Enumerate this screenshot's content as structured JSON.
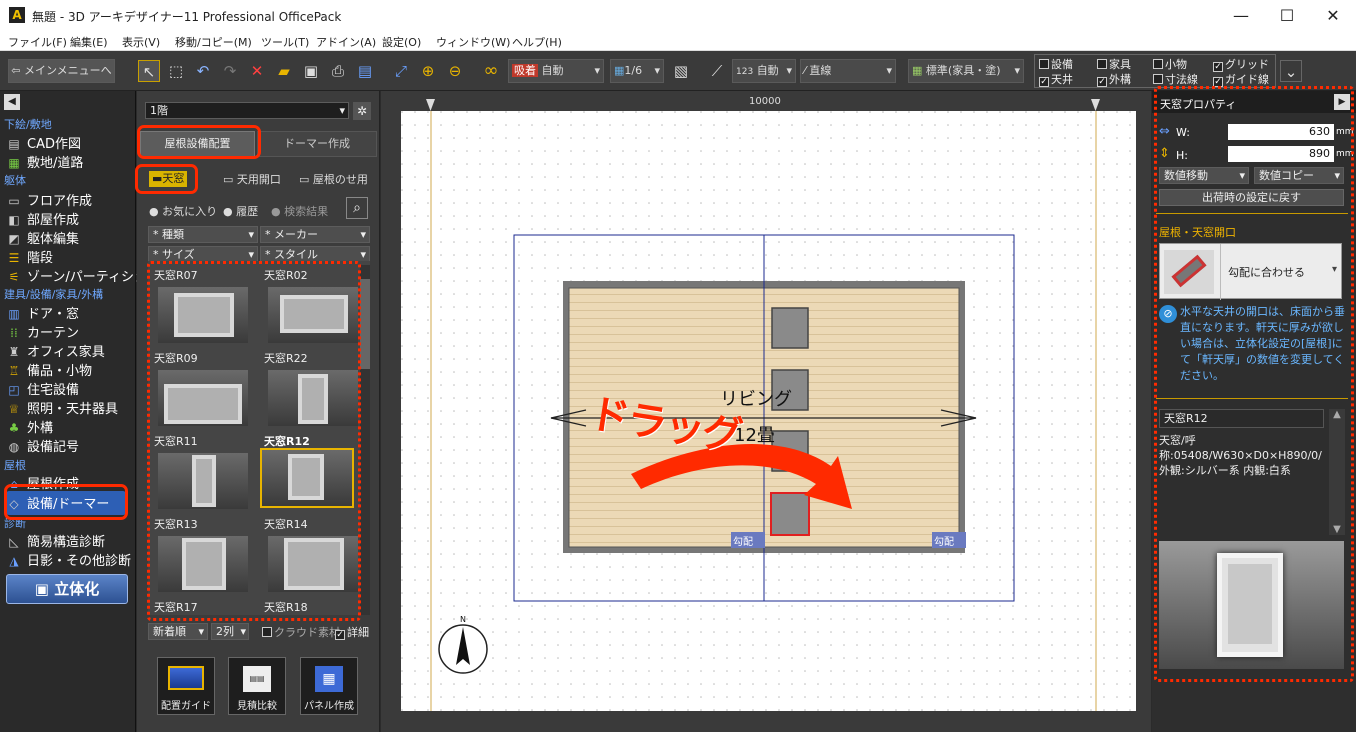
{
  "window": {
    "title": "無題 - 3D アーキデザイナー11 Professional OfficePack",
    "min": "—",
    "max": "☐",
    "close": "✕"
  },
  "menu": [
    "ファイル(F)",
    "編集(E)",
    "表示(V)",
    "移動/コピー(M)",
    "ツール(T)",
    "アドイン(A)",
    "設定(O)",
    "ウィンドウ(W)",
    "ヘルプ(H)"
  ],
  "toolbar": {
    "main_menu": "メインメニューへ",
    "snap_label": "吸着",
    "snap_value": "自動",
    "grid_value": "1/6",
    "dim_value": "自動",
    "line_value": "直線",
    "standard_value": "標準(家具・塗)",
    "checks": [
      {
        "label": "設備",
        "checked": false
      },
      {
        "label": "家具",
        "checked": false
      },
      {
        "label": "小物",
        "checked": false
      },
      {
        "label": "グリッド",
        "checked": true
      },
      {
        "label": "天井",
        "checked": true
      },
      {
        "label": "外構",
        "checked": true
      },
      {
        "label": "寸法線",
        "checked": false
      },
      {
        "label": "ガイド線",
        "checked": true
      }
    ]
  },
  "leftnav": {
    "sections": [
      "下絵/敷地",
      "躯体",
      "建具/設備/家具/外構",
      "屋根",
      "診断"
    ],
    "items": [
      "CAD作図",
      "敷地/道路",
      "フロア作成",
      "部屋作成",
      "躯体編集",
      "階段",
      "ゾーン/パーティション",
      "ドア・窓",
      "カーテン",
      "オフィス家具",
      "備品・小物",
      "住宅設備",
      "照明・天井器具",
      "外構",
      "設備記号",
      "屋根作成",
      "設備/ドーマー",
      "簡易構造診断",
      "日影・その他診断"
    ],
    "render_button": "立体化"
  },
  "panel": {
    "floor": "1階",
    "tabs": [
      "屋根設備配置",
      "ドーマー作成"
    ],
    "categories": [
      "天窓",
      "天用開口",
      "屋根のせ用"
    ],
    "filters": [
      "お気に入り",
      "履歴",
      "検索結果"
    ],
    "dropdowns": [
      "* 種類",
      "* メーカー",
      "* サイズ",
      "* スタイル"
    ],
    "tiles": [
      "天窓R07",
      "天窓R02",
      "天窓R09",
      "天窓R22",
      "天窓R11",
      "天窓R12",
      "天窓R13",
      "天窓R14",
      "天窓R17",
      "天窓R18"
    ],
    "selected_tile": "天窓R12",
    "sort": "新着順",
    "cols": "2列",
    "cloud": "クラウド素材",
    "detail": "詳細",
    "bottom_buttons": [
      "配置ガイド",
      "見積比較",
      "パネル作成"
    ]
  },
  "canvas": {
    "ruler_value": "10000",
    "room_name": "リビング",
    "room_size": "12畳",
    "slope_label": "勾配",
    "drag_annotation": "ドラッグ"
  },
  "right": {
    "header": "天窓プロパティ",
    "w_label": "W:",
    "w_value": "630",
    "h_label": "H:",
    "h_value": "890",
    "unit": "mm",
    "move_mode": "数値移動",
    "copy_mode": "数値コピー",
    "reset": "出荷時の設定に戻す",
    "roof_section": "屋根・天窓開口",
    "fit_mode": "勾配に合わせる",
    "note": "水平な天井の開口は、床面から垂直になります。軒天に厚みが欲しい場合は、立体化設定の[屋根]にて「軒天厚」の数値を変更してください。",
    "item_name": "天窓R12",
    "item_desc": "天窓/呼称:05408/W630×D0×H890/0/外観:シルバー系 内観:白系"
  },
  "colors": {
    "accent_red": "#ff2a00",
    "room_fill": "#ecd9b6",
    "wall": "#777777"
  }
}
